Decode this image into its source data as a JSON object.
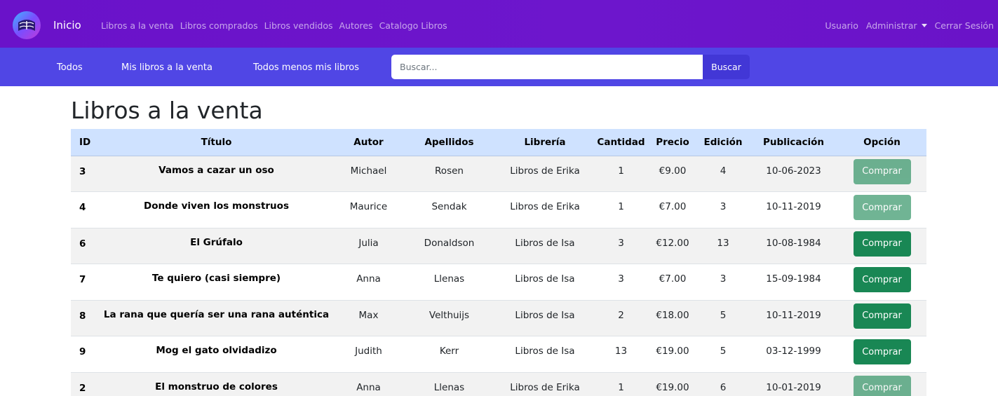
{
  "navbar": {
    "brand": "Inicio",
    "links": [
      "Libros a la venta",
      "Libros comprados",
      "Libros vendidos",
      "Autores",
      "Catalogo Libros"
    ],
    "right": {
      "user": "Usuario",
      "admin": "Administrar",
      "logout": "Cerrar Sesión"
    }
  },
  "subnav": {
    "tabs": [
      "Todos",
      "Mis libros a la venta",
      "Todos menos mis libros"
    ],
    "search": {
      "placeholder": "Buscar...",
      "button": "Buscar"
    }
  },
  "page_title": "Libros a la venta",
  "table": {
    "headers": [
      "ID",
      "Título",
      "Autor",
      "Apellidos",
      "Librería",
      "Cantidad",
      "Precio",
      "Edición",
      "Publicación",
      "Opción"
    ],
    "rows": [
      {
        "id": "3",
        "titulo": "Vamos a cazar un oso",
        "autor": "Michael",
        "apellidos": "Rosen",
        "libreria": "Libros de Erika",
        "cantidad": "1",
        "precio": "€9.00",
        "edicion": "4",
        "publicacion": "10-06-2023",
        "opcion": "Comprar",
        "enabled": false
      },
      {
        "id": "4",
        "titulo": "Donde viven los monstruos",
        "autor": "Maurice",
        "apellidos": "Sendak",
        "libreria": "Libros de Erika",
        "cantidad": "1",
        "precio": "€7.00",
        "edicion": "3",
        "publicacion": "10-11-2019",
        "opcion": "Comprar",
        "enabled": false
      },
      {
        "id": "6",
        "titulo": "El Grúfalo",
        "autor": "Julia",
        "apellidos": "Donaldson",
        "libreria": "Libros de Isa",
        "cantidad": "3",
        "precio": "€12.00",
        "edicion": "13",
        "publicacion": "10-08-1984",
        "opcion": "Comprar",
        "enabled": true
      },
      {
        "id": "7",
        "titulo": "Te quiero (casi siempre)",
        "autor": "Anna",
        "apellidos": "Llenas",
        "libreria": "Libros de Isa",
        "cantidad": "3",
        "precio": "€7.00",
        "edicion": "3",
        "publicacion": "15-09-1984",
        "opcion": "Comprar",
        "enabled": true
      },
      {
        "id": "8",
        "titulo": "La rana que quería ser una rana auténtica",
        "autor": "Max",
        "apellidos": "Velthuijs",
        "libreria": "Libros de Isa",
        "cantidad": "2",
        "precio": "€18.00",
        "edicion": "5",
        "publicacion": "10-11-2019",
        "opcion": "Comprar",
        "enabled": true
      },
      {
        "id": "9",
        "titulo": "Mog el gato olvidadizo",
        "autor": "Judith",
        "apellidos": "Kerr",
        "libreria": "Libros de Isa",
        "cantidad": "13",
        "precio": "€19.00",
        "edicion": "5",
        "publicacion": "03-12-1999",
        "opcion": "Comprar",
        "enabled": true
      },
      {
        "id": "2",
        "titulo": "El monstruo de colores",
        "autor": "Anna",
        "apellidos": "Llenas",
        "libreria": "Libros de Erika",
        "cantidad": "1",
        "precio": "€19.00",
        "edicion": "6",
        "publicacion": "10-01-2019",
        "opcion": "Comprar",
        "enabled": false
      }
    ]
  },
  "colors": {
    "navbar": "#6a12c9",
    "subnav": "#5046e5",
    "table_header": "#cfe2ff",
    "buy_button": "#198754"
  },
  "icons": {
    "logo": "book-logo-icon",
    "admin_caret": "caret-down-icon"
  }
}
